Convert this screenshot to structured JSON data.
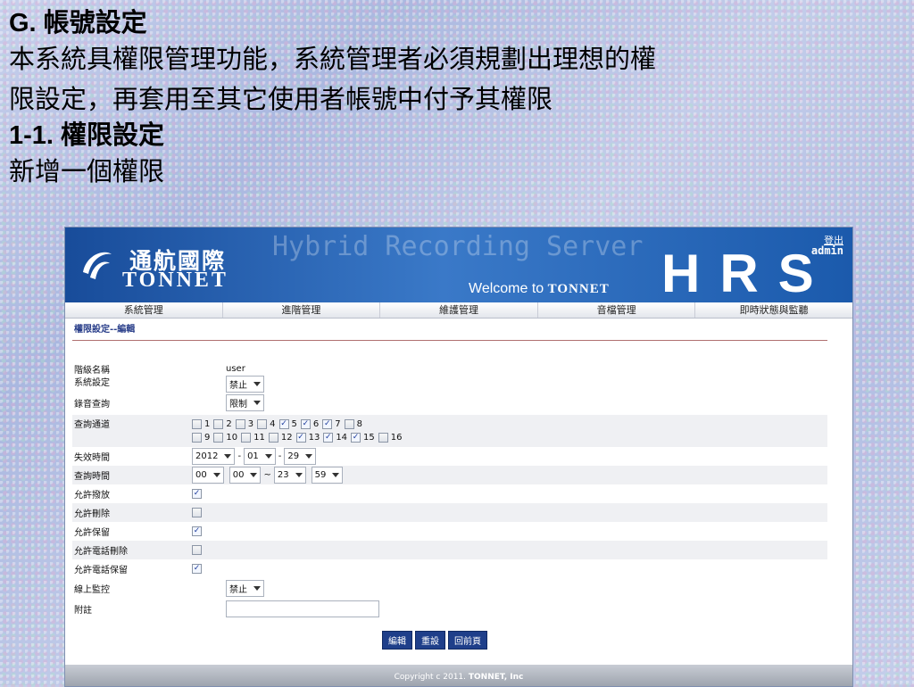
{
  "slide": {
    "heading": "G. 帳號設定",
    "desc_line1": "本系統具權限管理功能，系統管理者必須規劃出理想的權",
    "desc_line2": "限設定，再套用至其它使用者帳號中付予其權限",
    "subheading": "1-1. 權限設定",
    "subdesc": "新增一個權限"
  },
  "app": {
    "brand_cn": "通航國際",
    "brand_en": "TONNET",
    "product": "Hybrid Recording Server",
    "welcome_prefix": "Welcome to",
    "welcome_brand": "TONNET",
    "hrs": "HRS",
    "logout": "登出",
    "user": "admin",
    "colors": {
      "banner": "#1f5bb0",
      "button": "#1f3f8a",
      "accent": "#2a3f8a"
    }
  },
  "nav": [
    "系統管理",
    "進階管理",
    "維護管理",
    "音檔管理",
    "即時狀態與監聽"
  ],
  "section_title": "權限設定--編輯",
  "form": {
    "level_name_label": "階級名稱",
    "level_name_value": "user",
    "system_setting_label": "系統設定",
    "system_setting_value": "禁止",
    "record_query_label": "錄音查詢",
    "record_query_value": "限制",
    "channels_label": "查詢通道",
    "channels": [
      {
        "n": "1",
        "checked": false
      },
      {
        "n": "2",
        "checked": false
      },
      {
        "n": "3",
        "checked": false
      },
      {
        "n": "4",
        "checked": false
      },
      {
        "n": "5",
        "checked": true
      },
      {
        "n": "6",
        "checked": true
      },
      {
        "n": "7",
        "checked": true
      },
      {
        "n": "8",
        "checked": false
      },
      {
        "n": "9",
        "checked": false
      },
      {
        "n": "10",
        "checked": false
      },
      {
        "n": "11",
        "checked": false
      },
      {
        "n": "12",
        "checked": false
      },
      {
        "n": "13",
        "checked": true
      },
      {
        "n": "14",
        "checked": true
      },
      {
        "n": "15",
        "checked": true
      },
      {
        "n": "16",
        "checked": false
      }
    ],
    "expire_label": "失效時間",
    "expire_year": "2012",
    "expire_month": "01",
    "expire_day": "29",
    "query_time_label": "查詢時間",
    "time_start_h": "00",
    "time_start_m": "00",
    "time_end_h": "23",
    "time_end_m": "59",
    "allow_play_label": "允許撥放",
    "allow_play": true,
    "allow_delete_label": "允許刪除",
    "allow_delete": false,
    "allow_keep_label": "允許保留",
    "allow_keep": true,
    "allow_phone_delete_label": "允許電話刪除",
    "allow_phone_delete": false,
    "allow_phone_keep_label": "允許電話保留",
    "allow_phone_keep": true,
    "online_monitor_label": "線上監控",
    "online_monitor_value": "禁止",
    "note_label": "附註",
    "note_value": ""
  },
  "buttons": {
    "edit": "編輯",
    "reset": "重設",
    "back": "回前頁"
  },
  "footer": {
    "prefix": "Copyright c 2011.",
    "brand": "TONNET, Inc"
  }
}
